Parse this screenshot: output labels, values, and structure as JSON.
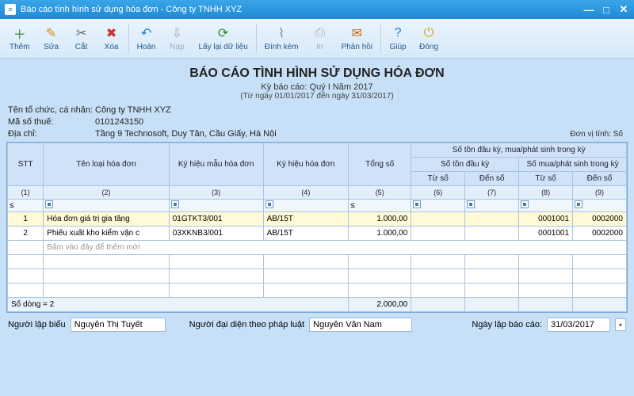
{
  "window": {
    "title": "Báo cáo tình hình sử dụng hóa đơn - Công ty TNHH XYZ"
  },
  "toolbar": {
    "them": "Thêm",
    "sua": "Sửa",
    "cat": "Cắt",
    "xoa": "Xóa",
    "hoan": "Hoàn",
    "nap": "Nạp",
    "laylai": "Lấy lại dữ liệu",
    "dinhkem": "Đính kèm",
    "in": "In",
    "phanhoi": "Phản hồi",
    "giup": "Giúp",
    "dong": "Đóng"
  },
  "report": {
    "title": "BÁO CÁO TÌNH HÌNH SỬ DỤNG HÓA ĐƠN",
    "period": "Kỳ báo cáo: Quý I Năm 2017",
    "range": "(Từ ngày 01/01/2017 đến ngày 31/03/2017)"
  },
  "meta": {
    "org_lbl": "Tên tổ chức, cá nhân:",
    "org": "Công ty TNHH XYZ",
    "tax_lbl": "Mã số thuế:",
    "tax": "0101243150",
    "addr_lbl": "Địa chỉ:",
    "addr": "Tầng 9 Technosoft, Duy Tân, Cầu Giấy, Hà Nội",
    "unit": "Đơn vị tính: Số"
  },
  "headers": {
    "stt": "STT",
    "tenloai": "Tên loại hóa đơn",
    "kymau": "Ký hiệu mẫu hóa đơn",
    "kyhd": "Ký hiệu hóa đơn",
    "tongso": "Tổng số",
    "grp1": "Số tồn đầu kỳ, mua/phát sinh trong kỳ",
    "grp2": "Số tồn đầu kỳ",
    "grp3": "Số mua/phát sinh trong kỳ",
    "tuso": "Từ số",
    "denso": "Đến số"
  },
  "colnums": [
    "(1)",
    "(2)",
    "(3)",
    "(4)",
    "(5)",
    "(6)",
    "(7)",
    "(8)",
    "(9)"
  ],
  "rows": [
    {
      "stt": "1",
      "ten": "Hóa đơn giá trị gia tăng",
      "mau": "01GTKT3/001",
      "ky": "AB/15T",
      "tong": "1.000,00",
      "dk_tu": "",
      "dk_den": "",
      "ps_tu": "0001001",
      "ps_den": "0002000"
    },
    {
      "stt": "2",
      "ten": "Phiếu xuất kho kiểm vận c",
      "mau": "03XKNB3/001",
      "ky": "AB/15T",
      "tong": "1.000,00",
      "dk_tu": "",
      "dk_den": "",
      "ps_tu": "0001001",
      "ps_den": "0002000"
    }
  ],
  "addrow": "Bấm vào đây để thêm mới",
  "sum": {
    "label": "Số dòng = 2",
    "tong": "2.000,00"
  },
  "footer": {
    "lap_lbl": "Người lập biểu",
    "lap": "Nguyễn Thị Tuyết",
    "dd_lbl": "Người đại diện theo pháp luật",
    "dd": "Nguyễn Văn Nam",
    "ngay_lbl": "Ngày lập báo cáo:",
    "ngay": "31/03/2017"
  }
}
